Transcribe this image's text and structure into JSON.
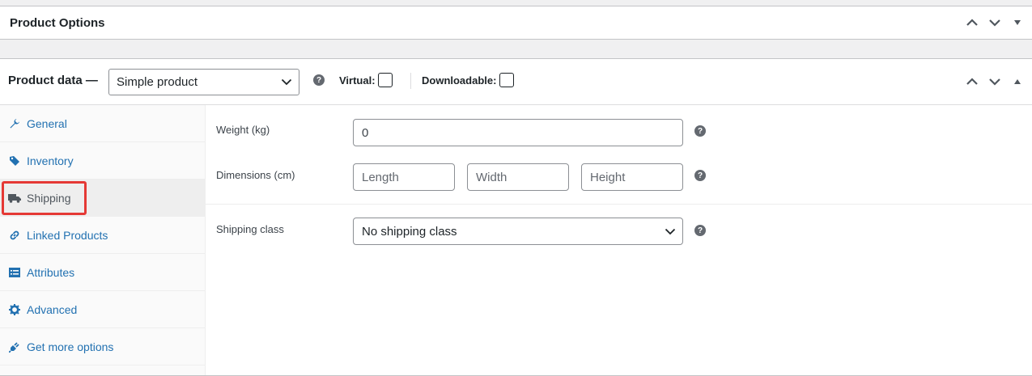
{
  "product_options": {
    "title": "Product Options"
  },
  "product_data": {
    "label": "Product data —",
    "type_select": "Simple product",
    "virtual_label": "Virtual:",
    "downloadable_label": "Downloadable:",
    "help_glyph": "?"
  },
  "tabs": [
    {
      "label": "General",
      "icon": "wrench-icon"
    },
    {
      "label": "Inventory",
      "icon": "tag-icon"
    },
    {
      "label": "Shipping",
      "icon": "truck-icon"
    },
    {
      "label": "Linked Products",
      "icon": "link-icon"
    },
    {
      "label": "Attributes",
      "icon": "list-icon"
    },
    {
      "label": "Advanced",
      "icon": "gear-icon"
    },
    {
      "label": "Get more options",
      "icon": "plugin-icon"
    }
  ],
  "active_tab": "Shipping",
  "shipping": {
    "weight_label": "Weight (kg)",
    "weight_placeholder": "0",
    "dimensions_label": "Dimensions (cm)",
    "length_placeholder": "Length",
    "width_placeholder": "Width",
    "height_placeholder": "Height",
    "class_label": "Shipping class",
    "class_value": "No shipping class"
  },
  "colors": {
    "link": "#2271b1",
    "highlight": "#e53935",
    "border": "#c3c4c7"
  }
}
